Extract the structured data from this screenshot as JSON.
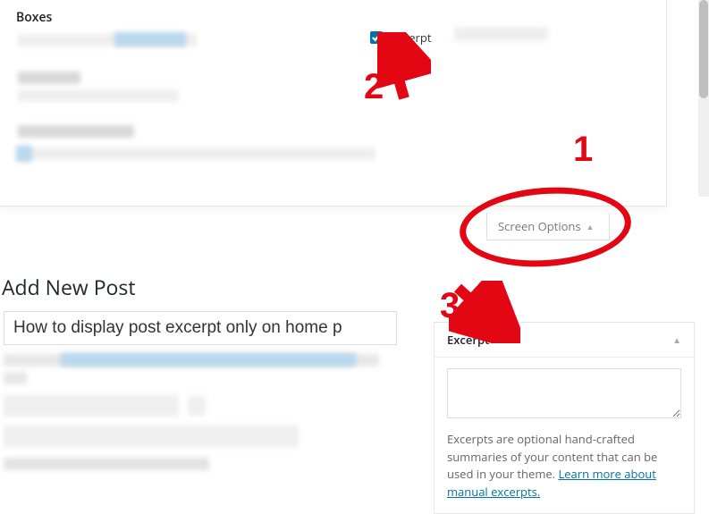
{
  "screen_options_panel": {
    "title": "Boxes",
    "excerpt_checkbox_label": "Excerpt",
    "excerpt_checked": true
  },
  "screen_options_tab": {
    "label": "Screen Options"
  },
  "editor": {
    "page_heading": "Add New Post",
    "title_value": "How to display post excerpt only on home p"
  },
  "excerpt_metabox": {
    "heading": "Excerpt",
    "value": "",
    "description": "Excerpts are optional hand-crafted summaries of your content that can be used in your theme. ",
    "link_text": "Learn more about manual excerpts."
  },
  "annotations": {
    "step1": "1",
    "step2": "2",
    "step3": "3"
  }
}
